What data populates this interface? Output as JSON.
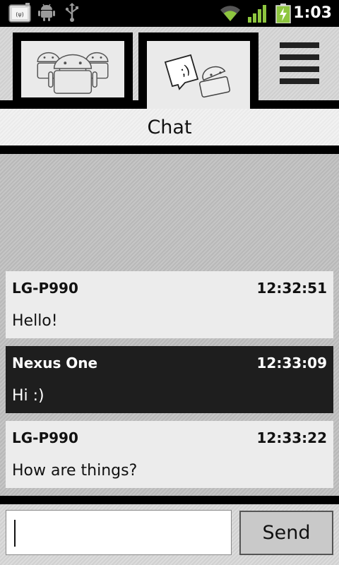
{
  "statusbar": {
    "time": "1:03",
    "icons": [
      "wireless-notification-icon",
      "android-debug-icon",
      "usb-icon",
      "wifi-icon",
      "signal-icon",
      "battery-charging-icon"
    ]
  },
  "tabs": [
    {
      "name": "groups",
      "icon": "android-group-icon",
      "selected": false
    },
    {
      "name": "chat",
      "icon": "chat-bubble-android-icon",
      "selected": true
    }
  ],
  "menu": {
    "icon": "menu-icon"
  },
  "title": "Chat",
  "messages": [
    {
      "sender": "LG-P990",
      "time": "12:32:51",
      "text": "Hello!",
      "style": "light"
    },
    {
      "sender": "Nexus One",
      "time": "12:33:09",
      "text": "Hi :)",
      "style": "dark"
    },
    {
      "sender": "LG-P990",
      "time": "12:33:22",
      "text": "How are things?",
      "style": "light"
    }
  ],
  "composer": {
    "value": "",
    "placeholder": "",
    "send_label": "Send"
  },
  "colors": {
    "statusbar": "#000000",
    "battery_green": "#8ec63f",
    "signal_green": "#8ec63f",
    "dark_message": "#1e1e1e",
    "light_message": "#ececec"
  }
}
